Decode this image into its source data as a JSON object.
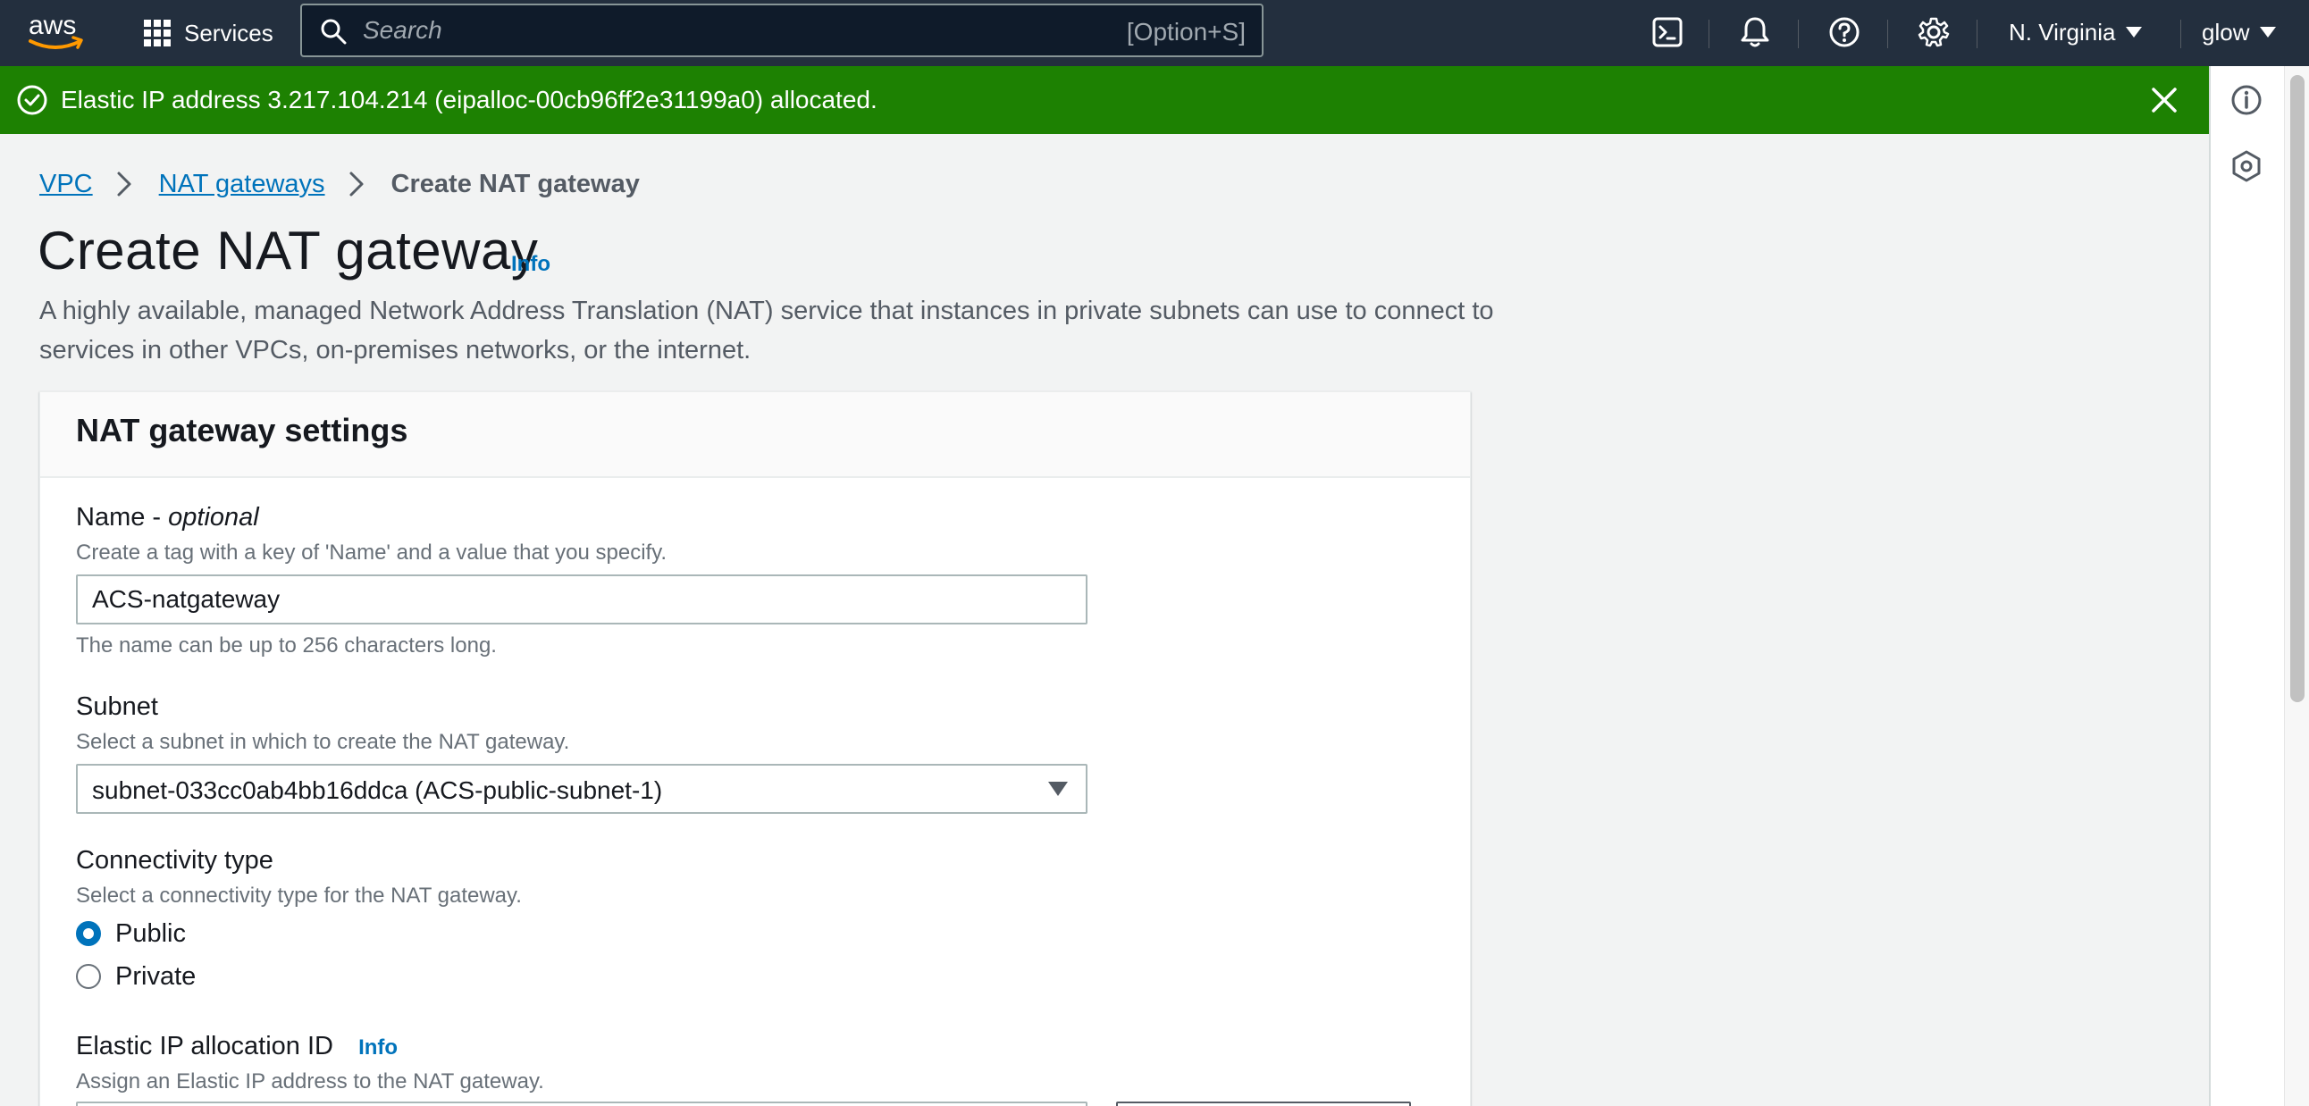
{
  "nav": {
    "logo": "aws",
    "services_label": "Services",
    "search_placeholder": "Search",
    "search_shortcut": "[Option+S]",
    "region": "N. Virginia",
    "user": "glow",
    "icons": [
      "cloudshell-icon",
      "bell-icon",
      "help-icon",
      "gear-icon"
    ]
  },
  "flash": {
    "type": "success",
    "message": "Elastic IP address 3.217.104.214 (eipalloc-00cb96ff2e31199a0) allocated."
  },
  "breadcrumb": {
    "items": [
      "VPC",
      "NAT gateways"
    ],
    "current": "Create NAT gateway"
  },
  "header": {
    "title": "Create NAT gateway",
    "info": "Info",
    "description": "A highly available, managed Network Address Translation (NAT) service that instances in private subnets can use to connect to services in other VPCs, on-premises networks, or the internet."
  },
  "settings": {
    "title": "NAT gateway settings",
    "name": {
      "label": "Name - ",
      "label_optional": "optional",
      "description": "Create a tag with a key of 'Name' and a value that you specify.",
      "value": "ACS-natgateway",
      "constraint": "The name can be up to 256 characters long."
    },
    "subnet": {
      "label": "Subnet",
      "description": "Select a subnet in which to create the NAT gateway.",
      "value": "subnet-033cc0ab4bb16ddca (ACS-public-subnet-1)"
    },
    "connectivity": {
      "label": "Connectivity type",
      "description": "Select a connectivity type for the NAT gateway.",
      "options": [
        "Public",
        "Private"
      ],
      "selected": "Public"
    },
    "eip": {
      "label": "Elastic IP allocation ID",
      "info": "Info",
      "description": "Assign an Elastic IP address to the NAT gateway."
    }
  },
  "colors": {
    "nav_bg": "#232f3e",
    "success": "#1d8102",
    "link": "#0073bb"
  }
}
